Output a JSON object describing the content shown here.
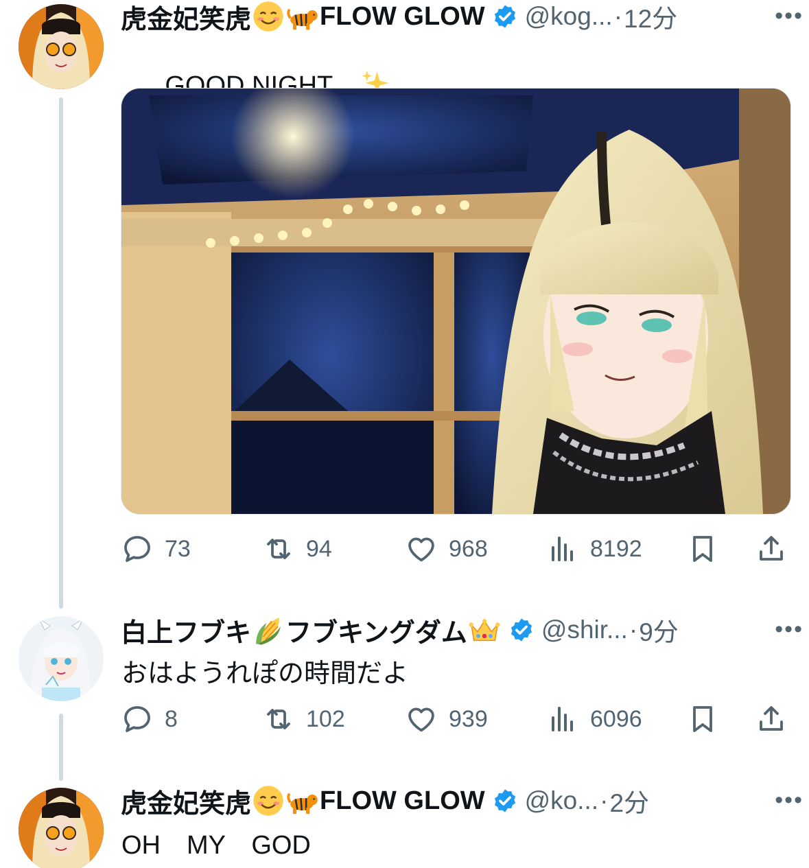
{
  "tweets": [
    {
      "display_name_main": "虎金妃笑虎",
      "display_name_tail": "FLOW GLOW",
      "handle": "@kog...",
      "dot": "·",
      "time": "12分",
      "more": "•••",
      "text": "GOOD NIGHT,,,,",
      "emoji_after_text": "sparkles-icon",
      "has_media": true,
      "stats": {
        "replies": "73",
        "retweets": "94",
        "likes": "968",
        "views": "8192"
      }
    },
    {
      "display_name_main": "白上フブキ",
      "display_name_tail": "フブキングダム",
      "handle": "@shir...",
      "dot": "·",
      "time": "9分",
      "more": "•••",
      "text": "おはようれぽの時間だよ",
      "stats": {
        "replies": "8",
        "retweets": "102",
        "likes": "939",
        "views": "6096"
      }
    },
    {
      "display_name_main": "虎金妃笑虎",
      "display_name_tail": "FLOW GLOW",
      "handle": "@ko...",
      "dot": "·",
      "time": "2分",
      "more": "•••",
      "text": "OH　MY　GOD"
    }
  ],
  "colors": {
    "verified": "#1d9bf0",
    "muted": "#536471",
    "text": "#0f1419",
    "thread_line": "#cfd9de"
  }
}
